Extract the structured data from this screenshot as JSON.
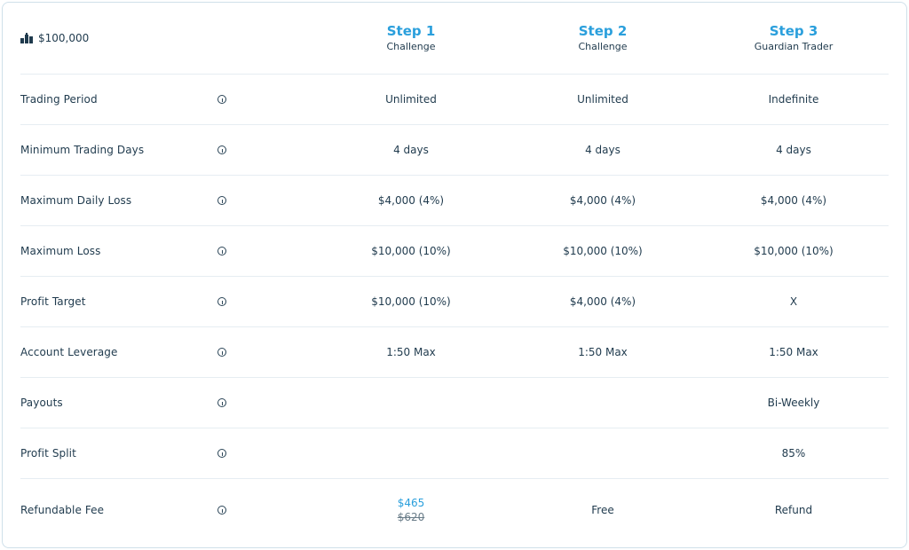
{
  "header": {
    "plan_icon": "podium-icon",
    "plan_amount": "$100,000",
    "steps": [
      {
        "title": "Step 1",
        "subtitle": "Challenge"
      },
      {
        "title": "Step 2",
        "subtitle": "Challenge"
      },
      {
        "title": "Step 3",
        "subtitle": "Guardian Trader"
      }
    ]
  },
  "rows": [
    {
      "label": "Trading Period",
      "values": [
        "Unlimited",
        "Unlimited",
        "Indefinite"
      ]
    },
    {
      "label": "Minimum Trading Days",
      "values": [
        "4 days",
        "4 days",
        "4 days"
      ]
    },
    {
      "label": "Maximum Daily Loss",
      "values": [
        "$4,000 (4%)",
        "$4,000 (4%)",
        "$4,000 (4%)"
      ]
    },
    {
      "label": "Maximum Loss",
      "values": [
        "$10,000 (10%)",
        "$10,000 (10%)",
        "$10,000 (10%)"
      ]
    },
    {
      "label": "Profit Target",
      "values": [
        "$10,000 (10%)",
        "$4,000 (4%)",
        "X"
      ]
    },
    {
      "label": "Account Leverage",
      "values": [
        "1:50 Max",
        "1:50 Max",
        "1:50 Max"
      ]
    },
    {
      "label": "Payouts",
      "values": [
        "",
        "",
        "Bi-Weekly"
      ]
    },
    {
      "label": "Profit Split",
      "values": [
        "",
        "",
        "85%"
      ]
    }
  ],
  "fee": {
    "label": "Refundable Fee",
    "step1_price": "$465",
    "step1_original_price": "$620",
    "step2": "Free",
    "step3": "Refund"
  },
  "colors": {
    "accent": "#2a9fdc",
    "text": "#1f3a4d",
    "border": "#cfe0ea"
  },
  "info_icon": "info-icon"
}
